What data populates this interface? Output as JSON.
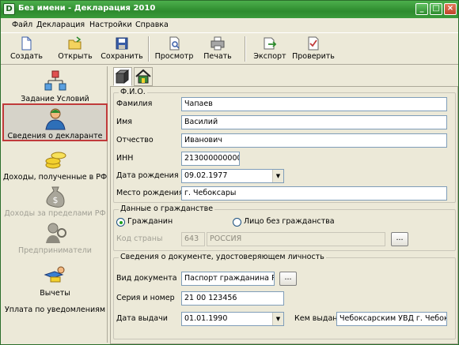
{
  "window": {
    "title": "Без имени - Декларация 2010"
  },
  "menu": [
    "Файл",
    "Декларация",
    "Настройки",
    "Справка"
  ],
  "toolbar": {
    "create": "Создать",
    "open": "Открыть",
    "save": "Сохранить",
    "preview": "Просмотр",
    "print": "Печать",
    "export": "Экспорт",
    "check": "Проверить"
  },
  "sidebar": [
    {
      "label": "Задание Условий",
      "icon": "conditions-icon",
      "state": "normal"
    },
    {
      "label": "Сведения о декларанте",
      "icon": "person-icon",
      "state": "selected"
    },
    {
      "label": "Доходы, полученные в РФ",
      "icon": "coins-icon",
      "state": "normal"
    },
    {
      "label": "Доходы за пределами РФ",
      "icon": "money-bag-icon",
      "state": "disabled"
    },
    {
      "label": "Предприниматели",
      "icon": "entrepreneur-icon",
      "state": "disabled"
    },
    {
      "label": "Вычеты",
      "icon": "deductions-icon",
      "state": "normal"
    },
    {
      "label": "Уплата по уведомлениям",
      "icon": "",
      "state": "normal"
    }
  ],
  "fio": {
    "title": "Ф.И.О.",
    "surname_label": "Фамилия",
    "surname": "Чапаев",
    "name_label": "Имя",
    "name": "Василий",
    "patronymic_label": "Отчество",
    "patronymic": "Иванович",
    "inn_label": "ИНН",
    "inn": "213000000000",
    "birthdate_label": "Дата рождения",
    "birthdate": "09.02.1977",
    "birthplace_label": "Место рождения",
    "birthplace": "г. Чебоксары"
  },
  "citizenship": {
    "title": "Данные о гражданстве",
    "option_citizen": "Гражданин",
    "option_stateless": "Лицо без гражданства",
    "country_label": "Код страны",
    "country_code": "643",
    "country_name": "РОССИЯ",
    "browse": "..."
  },
  "document": {
    "title": "Сведения о документе, удостоверяющем личность",
    "type_label": "Вид документа",
    "type": "Паспорт гражданина РФ",
    "browse": "...",
    "number_label": "Серия и номер",
    "number": "21 00 123456",
    "issue_date_label": "Дата выдачи",
    "issue_date": "01.01.1990",
    "issued_by_label": "Кем выдан",
    "issued_by": "Чебоксарским УВД г. Чебокс"
  }
}
